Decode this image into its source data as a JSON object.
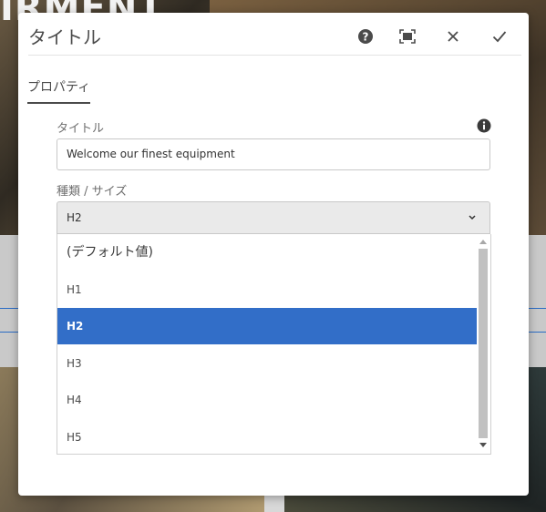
{
  "background": {
    "banner_text": "IRMENT"
  },
  "dialog": {
    "title": "タイトル",
    "toolbar": {
      "help_icon": "help-icon",
      "fullscreen_icon": "fullscreen-icon",
      "close_icon": "close-icon",
      "done_icon": "checkmark-icon"
    }
  },
  "tabs": [
    {
      "label": "プロパティ",
      "active": true
    }
  ],
  "form": {
    "title_field": {
      "label": "タイトル",
      "value": "Welcome our finest equipment",
      "info_icon": "info-icon"
    },
    "type_field": {
      "label": "種類 / サイズ",
      "selected": "H2",
      "options": [
        "(デフォルト値)",
        "H1",
        "H2",
        "H3",
        "H4",
        "H5"
      ]
    }
  },
  "colors": {
    "accent": "#326ec8",
    "text": "#4b4b4b"
  }
}
